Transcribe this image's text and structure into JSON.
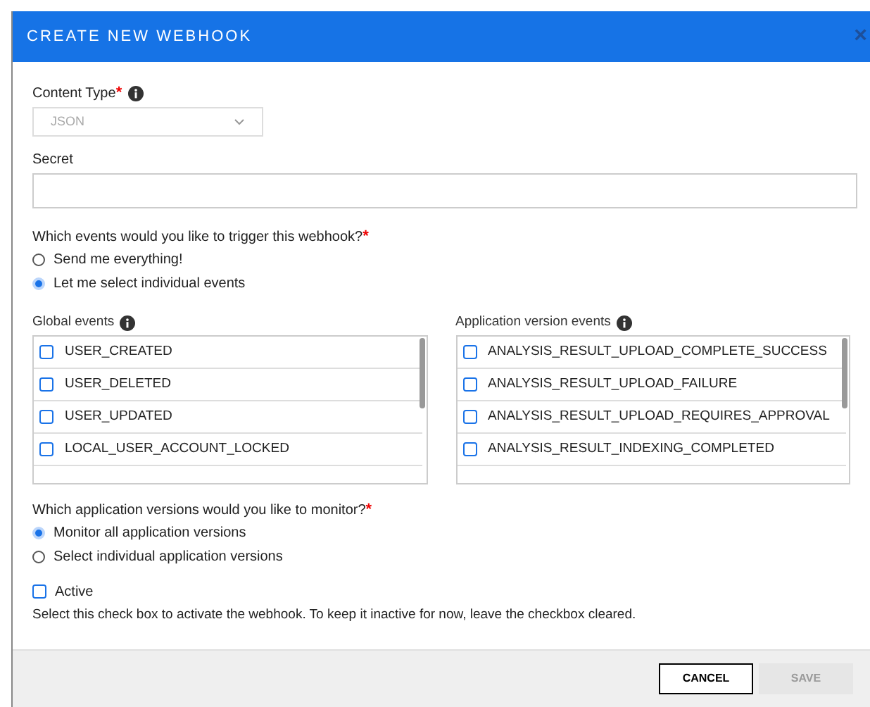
{
  "dialog": {
    "title": "CREATE NEW WEBHOOK",
    "close": "×"
  },
  "content_type": {
    "label": "Content Type",
    "required": "*",
    "value": "JSON",
    "disabled": true
  },
  "secret": {
    "label": "Secret"
  },
  "events_question": {
    "label": "Which events would you like to trigger this webhook?",
    "required": "*",
    "options": [
      {
        "label": "Send me everything!",
        "selected": false
      },
      {
        "label": "Let me select individual events",
        "selected": true
      }
    ]
  },
  "event_lists": [
    {
      "label": "Global events",
      "items": [
        {
          "label": "USER_CREATED",
          "checked": false
        },
        {
          "label": "USER_DELETED",
          "checked": false
        },
        {
          "label": "USER_UPDATED",
          "checked": false
        },
        {
          "label": "LOCAL_USER_ACCOUNT_LOCKED",
          "checked": false
        }
      ]
    },
    {
      "label": "Application version events",
      "items": [
        {
          "label": "ANALYSIS_RESULT_UPLOAD_COMPLETE_SUCCESS",
          "checked": false
        },
        {
          "label": "ANALYSIS_RESULT_UPLOAD_FAILURE",
          "checked": false
        },
        {
          "label": "ANALYSIS_RESULT_UPLOAD_REQUIRES_APPROVAL",
          "checked": false
        },
        {
          "label": "ANALYSIS_RESULT_INDEXING_COMPLETED",
          "checked": false
        }
      ]
    }
  ],
  "versions_question": {
    "label": "Which application versions would you like to monitor?",
    "required": "*",
    "options": [
      {
        "label": "Monitor all application versions",
        "selected": true
      },
      {
        "label": "Select individual application versions",
        "selected": false
      }
    ]
  },
  "active": {
    "label": "Active",
    "checked": false,
    "help": "Select this check box to activate the webhook. To keep it inactive for now, leave the checkbox cleared."
  },
  "buttons": [
    {
      "label": "CANCEL",
      "disabled": false
    },
    {
      "label": "SAVE",
      "disabled": true
    }
  ]
}
